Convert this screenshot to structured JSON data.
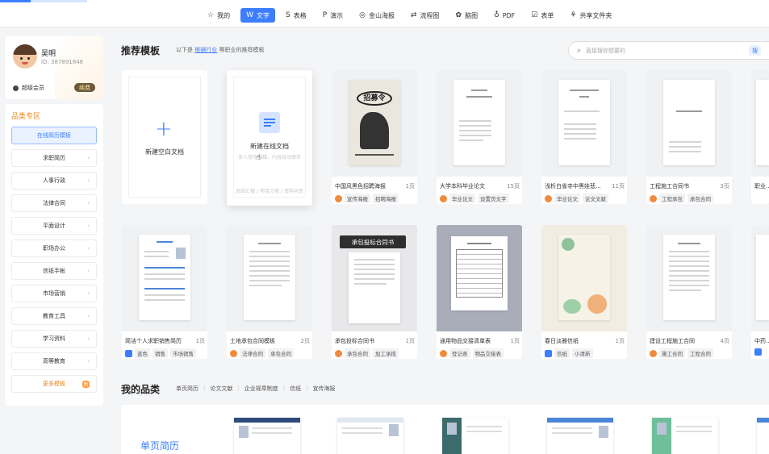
{
  "nav": [
    {
      "icon": "☆",
      "label": "我的",
      "active": false
    },
    {
      "icon": "W",
      "label": "文字",
      "active": true
    },
    {
      "icon": "S",
      "label": "表格",
      "active": false
    },
    {
      "icon": "P",
      "label": "演示",
      "active": false
    },
    {
      "icon": "◎",
      "label": "金山海报",
      "active": false
    },
    {
      "icon": "⇄",
      "label": "流程图",
      "active": false
    },
    {
      "icon": "✿",
      "label": "脑图",
      "active": false
    },
    {
      "icon": "♁",
      "label": "PDF",
      "active": false
    },
    {
      "icon": "☑",
      "label": "表单",
      "active": false
    },
    {
      "icon": "⚘",
      "label": "共享文件夹",
      "active": false
    }
  ],
  "user": {
    "name": "吴明",
    "id": "ID: 387891846",
    "vip": "超级会员",
    "renew": "续费"
  },
  "categories": {
    "title": "品类专区",
    "items": [
      "在线简历模板",
      "求职简历",
      "人事行政",
      "法律合同",
      "平面设计",
      "职场办公",
      "信纸手帐",
      "市场营销",
      "教育工具",
      "学习资料",
      "高等教育"
    ],
    "more": "更多模板",
    "more_badge": "新"
  },
  "main": {
    "title": "推荐模板",
    "sub_prefix": "以下是",
    "sub_link": "根据行业",
    "sub_suffix": "等职业的推荐模板",
    "search_placeholder": "直接搜你想要的",
    "search_btn": "搜"
  },
  "blank_card": {
    "label": "新建空白文档"
  },
  "online_card": {
    "label": "新建在线文档",
    "hint": "多人协作编辑，内容自动保存",
    "hint2": "总结汇报 | 项目方案 | 资料共享"
  },
  "cards_row1": [
    {
      "name": "中国风黑色招聘海报",
      "pages": "1页",
      "tags": [
        "宣传海报",
        "招聘海报"
      ],
      "icon": "orange",
      "poster_text": "招募令"
    },
    {
      "name": "大学本科毕业论文",
      "pages": "15页",
      "tags": [
        "毕业论文",
        "设置页文字"
      ],
      "icon": "orange"
    },
    {
      "name": "浅析白雀寺中黑娃悲...",
      "pages": "11页",
      "tags": [
        "毕业论文",
        "论文文献"
      ],
      "icon": "orange"
    },
    {
      "name": "工程施工合同书",
      "pages": "3页",
      "tags": [
        "工程承包",
        "承包合同"
      ],
      "icon": "orange"
    },
    {
      "name": "职业...",
      "pages": "",
      "tags": [],
      "icon": "orange"
    }
  ],
  "cards_row2": [
    {
      "name": "简洁个人求职销售简历",
      "pages": "1页",
      "tags": [
        "蓝色",
        "销售",
        "市场销售"
      ],
      "icon": "blue"
    },
    {
      "name": "土地承包合同模板",
      "pages": "2页",
      "tags": [
        "法律合同",
        "承包合同"
      ],
      "icon": "orange"
    },
    {
      "name": "承包投标合同书",
      "pages": "1页",
      "tags": [
        "承包合同",
        "加工承揽"
      ],
      "icon": "orange",
      "banner": "承包投标合同书"
    },
    {
      "name": "通用物品交接清单表",
      "pages": "1页",
      "tags": [
        "登记表",
        "物品交接表"
      ],
      "icon": "orange"
    },
    {
      "name": "春日淡雅信纸",
      "pages": "1页",
      "tags": [
        "信纸",
        "小清新"
      ],
      "icon": "blue"
    },
    {
      "name": "建设工程施工合同",
      "pages": "4页",
      "tags": [
        "施工合同",
        "工程合同"
      ],
      "icon": "orange"
    },
    {
      "name": "中药...",
      "pages": "",
      "tags": [],
      "icon": "blue"
    }
  ],
  "section2": {
    "title": "我的品类",
    "tabs": [
      "单页简历",
      "论文文献",
      "企业规章制度",
      "信纸",
      "宣传海报"
    ],
    "big_label": "单页简历"
  }
}
